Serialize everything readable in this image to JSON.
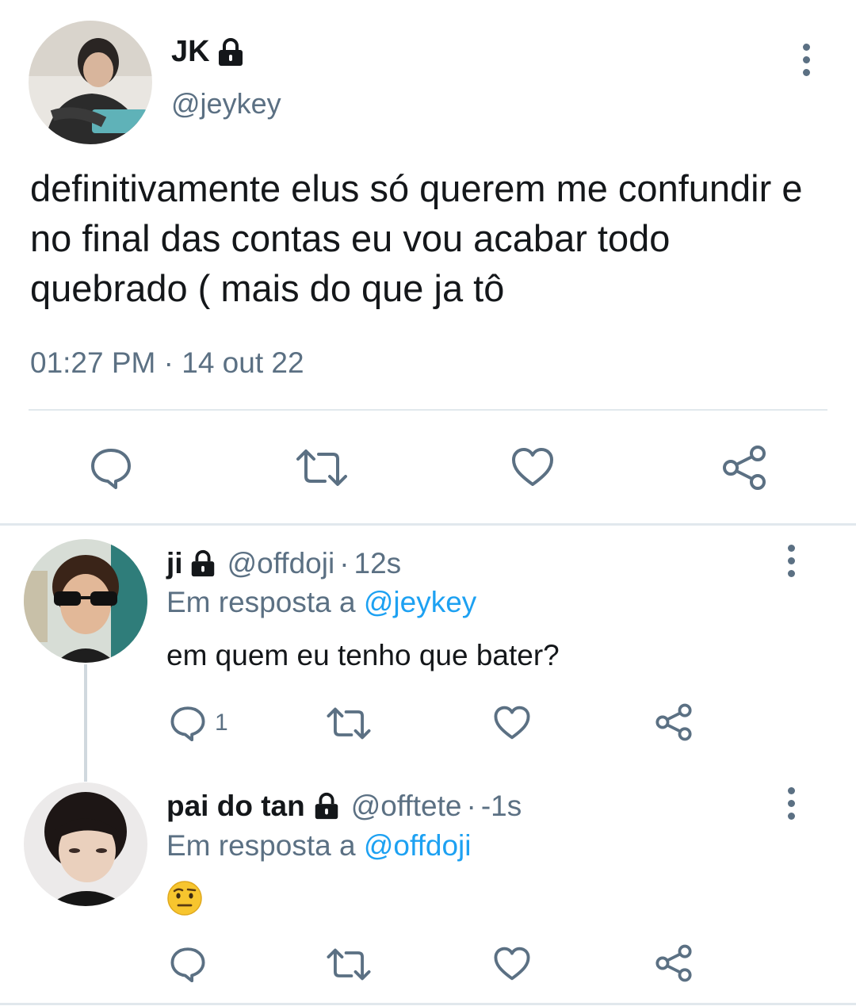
{
  "main_tweet": {
    "name": "JK",
    "handle": "@jeykey",
    "text": "definitivamente elus só querem me confundir e no final das contas eu vou acabar todo quebrado ( mais do que ja tô",
    "timestamp": "01:27 PM · 14 out 22",
    "actions": [
      "reply-icon",
      "retweet-icon",
      "like-icon",
      "share-icon"
    ]
  },
  "replies": [
    {
      "name": "ji",
      "handle": "@offdoji",
      "separator": "·",
      "time": "12s",
      "reply_to_label": "Em resposta a",
      "reply_to_handle": "@jeykey",
      "text": "em quem eu tenho que bater?",
      "reply_count": "1"
    },
    {
      "name": "pai do tan",
      "handle": "@offtete",
      "separator": "·",
      "time": "-1s",
      "reply_to_label": "Em resposta a",
      "reply_to_handle": "@offdoji",
      "text": "🤨",
      "reply_count": ""
    }
  ],
  "colors": {
    "text": "#14171a",
    "secondary": "#5b7083",
    "link": "#1da1f2",
    "divider": "#e1e8ed"
  }
}
